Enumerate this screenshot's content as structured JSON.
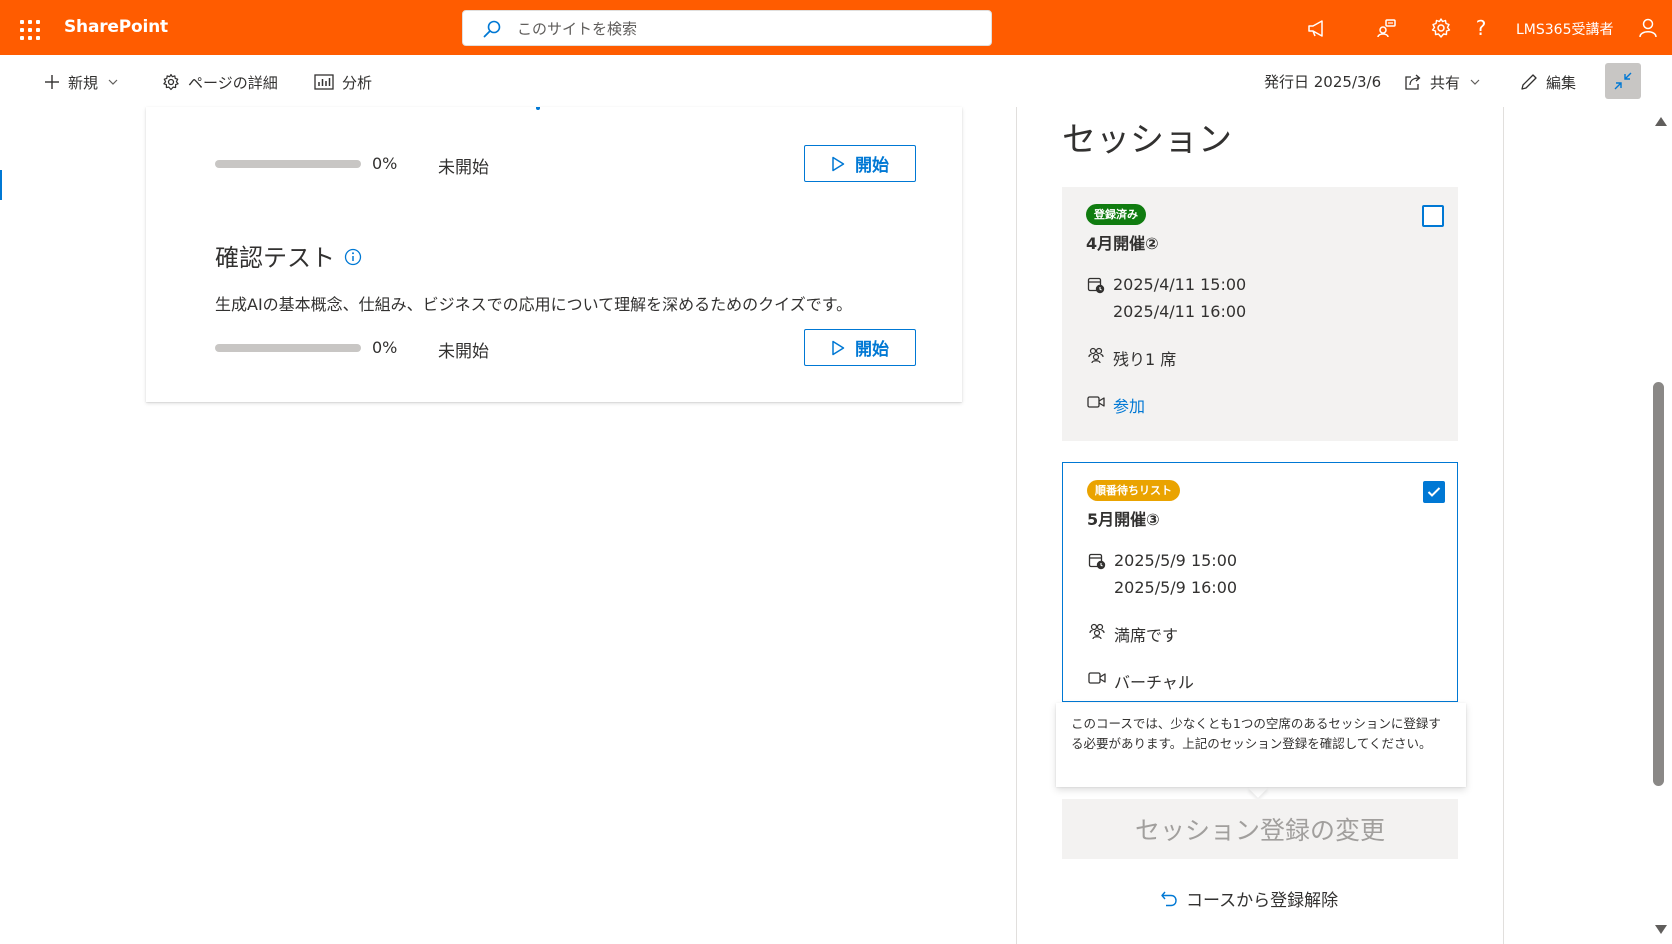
{
  "suite_bar": {
    "brand": "SharePoint",
    "search_placeholder": "このサイトを検索",
    "help_label": "?",
    "user_name": "LMS365受講者",
    "background": "#ff5c00"
  },
  "command_bar": {
    "new_label": "新規",
    "page_details_label": "ページの詳細",
    "analytics_label": "分析",
    "published_label": "発行日 2025/3/6",
    "share_label": "共有",
    "edit_label": "編集"
  },
  "course_items": [
    {
      "progress_value": 0,
      "progress_text": "0%",
      "status": "未開始",
      "start_label": "開始"
    },
    {
      "title": "確認テスト",
      "description": "生成AIの基本概念、仕組み、ビジネスでの応用について理解を深めるためのクイズです。",
      "progress_value": 0,
      "progress_text": "0%",
      "status": "未開始",
      "start_label": "開始"
    }
  ],
  "sessions_panel": {
    "title": "セッション",
    "sessions": [
      {
        "badge": "登録済み",
        "badge_color": "#107c10",
        "name": "4月開催②",
        "start": "2025/4/11 15:00",
        "end": "2025/4/11 16:00",
        "seats": "残り1 席",
        "location": "参加",
        "checked": false
      },
      {
        "badge": "順番待ちリスト",
        "badge_color": "#eaa300",
        "name": "5月開催③",
        "start": "2025/5/9 15:00",
        "end": "2025/5/9 16:00",
        "seats": "満席です",
        "location": "バーチャル",
        "checked": true
      }
    ],
    "tooltip": "このコースでは、少なくとも1つの空席のあるセッションに登録する必要があります。上記のセッション登録を確認してください。",
    "change_button": "セッション登録の変更",
    "unregister_label": "コースから登録解除"
  },
  "colors": {
    "accent": "#0078d4",
    "registered_badge": "#107c10",
    "waitlist_badge": "#eaa300"
  }
}
